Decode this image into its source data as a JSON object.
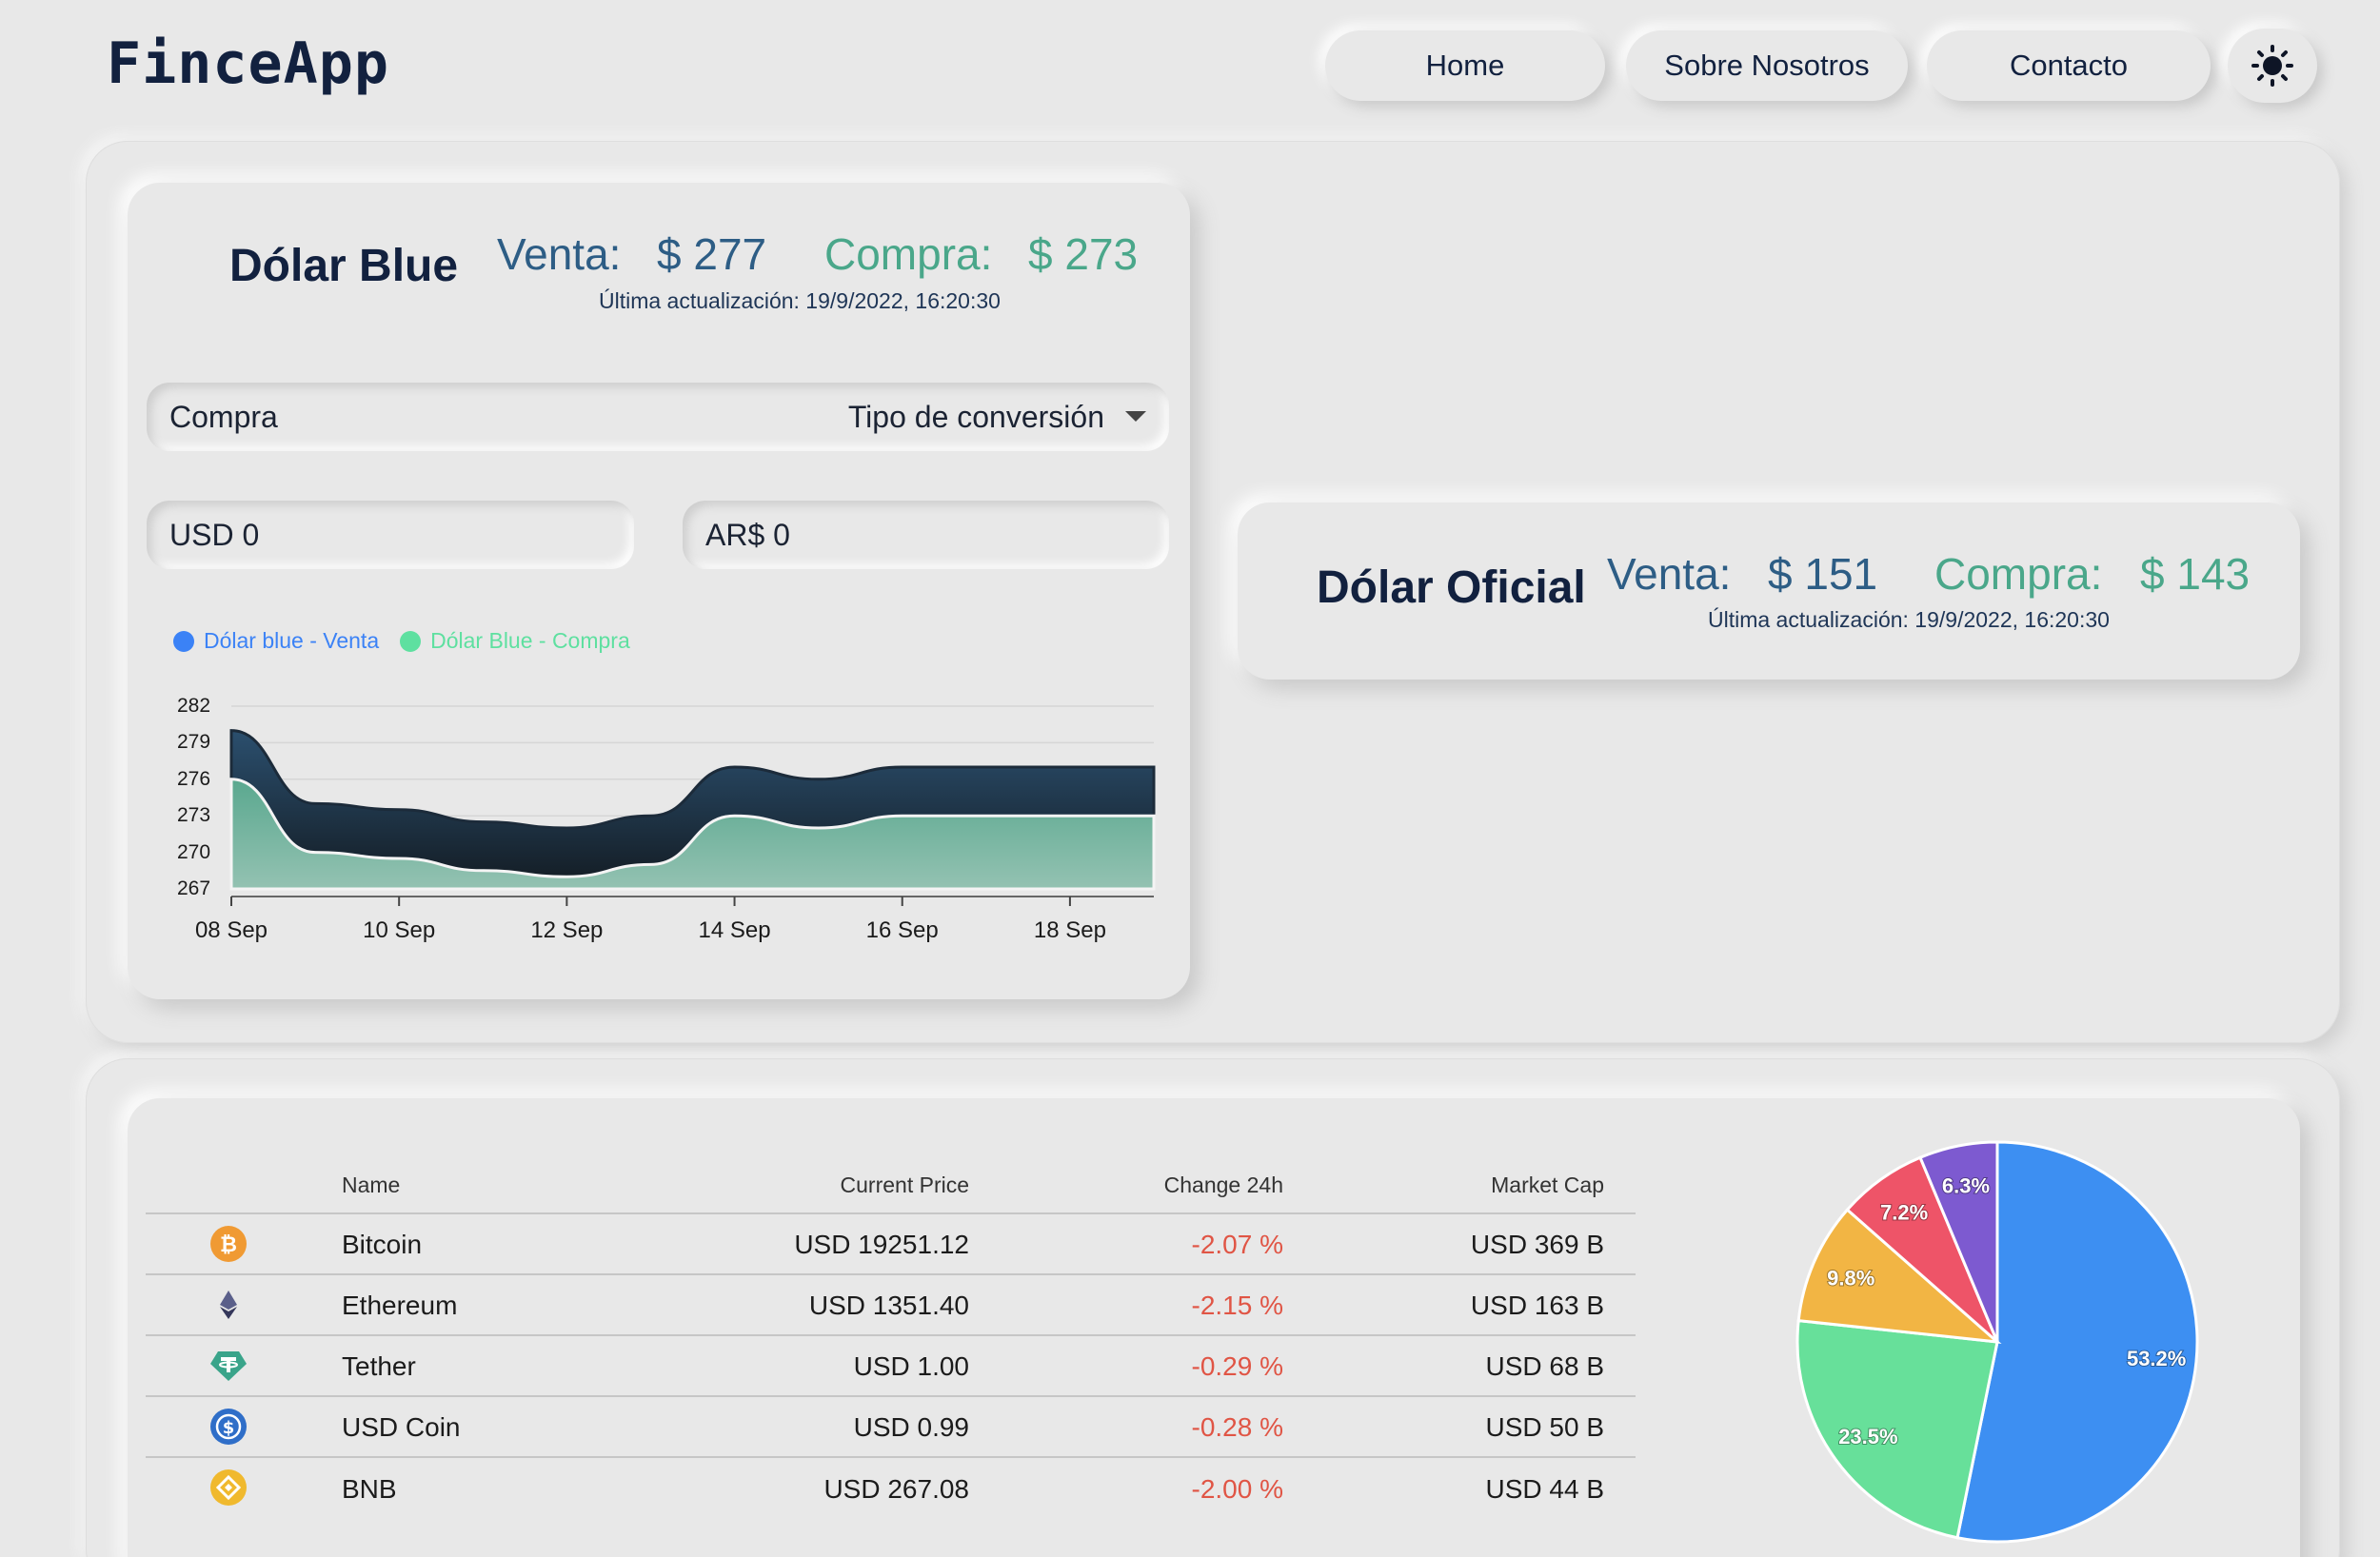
{
  "brand": "FinceApp",
  "nav": {
    "home": "Home",
    "about": "Sobre Nosotros",
    "contact": "Contacto",
    "theme_icon": "sun-icon"
  },
  "blue": {
    "title": "Dólar Blue",
    "venta_label": "Venta:",
    "venta_value": "$ 277",
    "compra_label": "Compra:",
    "compra_value": "$ 273",
    "updated": "Última actualización: 19/9/2022, 16:20:30"
  },
  "oficial": {
    "title": "Dólar Oficial",
    "venta_label": "Venta:",
    "venta_value": "$ 151",
    "compra_label": "Compra:",
    "compra_value": "$ 143",
    "updated": "Última actualización: 19/9/2022, 16:20:30"
  },
  "converter": {
    "mode_value": "Compra",
    "mode_label": "Tipo de conversión",
    "usd_value": "USD 0",
    "ars_value": "AR$ 0"
  },
  "chart_data": {
    "type": "area",
    "x": [
      "08 Sep",
      "09 Sep",
      "10 Sep",
      "11 Sep",
      "12 Sep",
      "13 Sep",
      "14 Sep",
      "15 Sep",
      "16 Sep",
      "17 Sep",
      "18 Sep",
      "19 Sep"
    ],
    "series": [
      {
        "name": "Dólar blue - Venta",
        "color": "#3b82f6",
        "values": [
          280,
          274,
          273.5,
          272.5,
          272,
          273,
          277,
          276,
          277,
          277,
          277,
          277
        ]
      },
      {
        "name": "Dólar Blue - Compra",
        "color": "#5ee0a0",
        "values": [
          276,
          270,
          269.5,
          268.5,
          268,
          269,
          273,
          272,
          273,
          273,
          273,
          273
        ]
      }
    ],
    "yticks": [
      "282",
      "279",
      "276",
      "273",
      "270",
      "267"
    ],
    "xticks": [
      "08 Sep",
      "10 Sep",
      "12 Sep",
      "14 Sep",
      "16 Sep",
      "18 Sep"
    ],
    "ylim": [
      267,
      282
    ]
  },
  "table": {
    "headers": {
      "name": "Name",
      "price": "Current Price",
      "change": "Change 24h",
      "cap": "Market Cap"
    },
    "rows": [
      {
        "icon": "bitcoin-icon",
        "name": "Bitcoin",
        "price": "USD 19251.12",
        "change": "-2.07 %",
        "cap": "USD 369 B"
      },
      {
        "icon": "ethereum-icon",
        "name": "Ethereum",
        "price": "USD 1351.40",
        "change": "-2.15 %",
        "cap": "USD 163 B"
      },
      {
        "icon": "tether-icon",
        "name": "Tether",
        "price": "USD 1.00",
        "change": "-0.29 %",
        "cap": "USD 68 B"
      },
      {
        "icon": "usd-coin-icon",
        "name": "USD Coin",
        "price": "USD 0.99",
        "change": "-0.28 %",
        "cap": "USD 50 B"
      },
      {
        "icon": "bnb-icon",
        "name": "BNB",
        "price": "USD 267.08",
        "change": "-2.00 %",
        "cap": "USD 44 B"
      }
    ]
  },
  "pie": {
    "type": "pie",
    "slices": [
      {
        "label": "53.2%",
        "value": 53.2,
        "color": "#3d8ff2"
      },
      {
        "label": "23.5%",
        "value": 23.5,
        "color": "#67e09a"
      },
      {
        "label": "9.8%",
        "value": 9.8,
        "color": "#f2b544"
      },
      {
        "label": "7.2%",
        "value": 7.2,
        "color": "#ee5468"
      },
      {
        "label": "6.3%",
        "value": 6.3,
        "color": "#7d5ad0"
      }
    ]
  }
}
